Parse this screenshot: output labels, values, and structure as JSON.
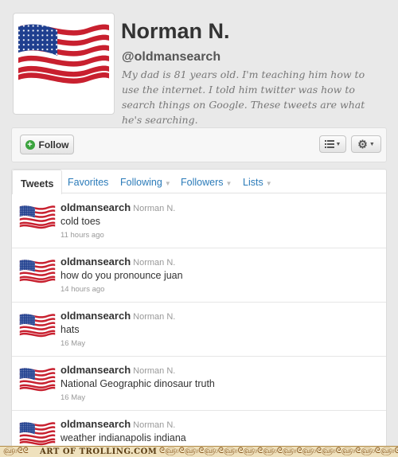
{
  "profile": {
    "name": "Norman N.",
    "handle": "@oldmansearch",
    "bio": "My dad is 81 years old. I'm teaching him how to use the internet. I told him twitter was how to search things on Google. These tweets are what he's searching."
  },
  "actions": {
    "follow_label": "Follow",
    "list_icon": "list-icon",
    "gear_icon": "gear-icon"
  },
  "tabs": [
    {
      "label": "Tweets",
      "active": true
    },
    {
      "label": "Favorites",
      "active": false
    },
    {
      "label": "Following",
      "active": false
    },
    {
      "label": "Followers",
      "active": false
    },
    {
      "label": "Lists",
      "active": false
    }
  ],
  "tweets": [
    {
      "user": "oldmansearch",
      "name": "Norman N.",
      "text": "cold toes",
      "time": "11 hours ago"
    },
    {
      "user": "oldmansearch",
      "name": "Norman N.",
      "text": "how do you pronounce juan",
      "time": "14 hours ago"
    },
    {
      "user": "oldmansearch",
      "name": "Norman N.",
      "text": "hats",
      "time": "16 May"
    },
    {
      "user": "oldmansearch",
      "name": "Norman N.",
      "text": "National Geographic dinosaur truth",
      "time": "16 May"
    },
    {
      "user": "oldmansearch",
      "name": "Norman N.",
      "text": "weather indianapolis indiana",
      "time": ""
    }
  ],
  "watermark": "ART OF TROLLING.COM",
  "colors": {
    "link": "#2b7bb9",
    "follow_green": "#3aa33d",
    "flag_red": "#c8202f",
    "flag_blue": "#1f3f8f"
  }
}
